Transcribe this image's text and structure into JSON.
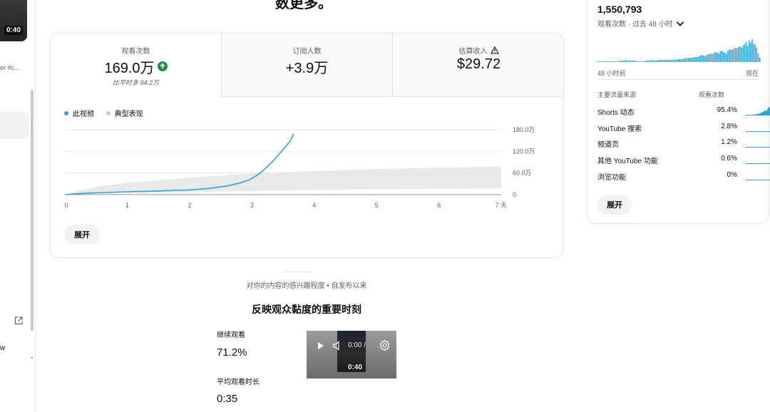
{
  "sidebar": {
    "thumbnail_duration": "0:40",
    "video_sub": "er #c...",
    "partial_text": "w"
  },
  "headline": "数更多。",
  "metrics": {
    "views": {
      "label": "观看次数",
      "value": "169.0万",
      "note": "比平时多 94.2万"
    },
    "subscribers": {
      "label": "订阅人数",
      "value": "+3.9万"
    },
    "revenue": {
      "label": "估算收入",
      "value": "$29.72"
    }
  },
  "legend": {
    "this_video": "此视频",
    "typical": "典型表现"
  },
  "expand_label": "展开",
  "chart_data": {
    "type": "line",
    "x_ticks": [
      "0",
      "1",
      "2",
      "3",
      "4",
      "5",
      "6",
      "7 天"
    ],
    "y_ticks": [
      "0",
      "60.0万",
      "120.0万",
      "180.0万"
    ],
    "ylim": [
      0,
      180
    ],
    "xlim": [
      0,
      7
    ],
    "grid": true,
    "legend_position": "top-left",
    "colors": {
      "this_video": "#2ba5d6",
      "typical": "#e2e2e2"
    },
    "series": [
      {
        "name": "此视频",
        "x": [
          0,
          0.25,
          0.5,
          1,
          1.5,
          2,
          2.3,
          2.6,
          2.8,
          2.95,
          3.05,
          3.15,
          3.25,
          3.35,
          3.45,
          3.55,
          3.62,
          3.67
        ],
        "y": [
          0,
          3,
          5,
          8,
          10,
          13,
          17,
          24,
          32,
          40,
          50,
          62,
          78,
          95,
          115,
          135,
          150,
          169
        ]
      },
      {
        "name": "典型表现",
        "x": [
          0,
          0.5,
          1,
          2,
          3,
          4,
          5,
          6,
          7
        ],
        "upper": [
          0,
          22,
          33,
          47,
          59,
          65,
          71,
          75,
          78
        ],
        "lower": [
          0,
          2,
          4,
          7,
          10,
          13,
          15,
          16,
          17
        ]
      }
    ]
  },
  "interest_text": "对你的内容的感兴趣程度 • 自发布以来",
  "moments_title": "反映观众黏度的重要时刻",
  "stats": {
    "continue_label": "继续观看",
    "continue_value": "71.2%",
    "avg_label": "平均观看时长",
    "avg_value": "0:35"
  },
  "player": {
    "time": "0:00 /",
    "duration": "0:40"
  },
  "realtime": {
    "total": "1,550,793",
    "subtitle": "观看次数 · 过去 48 小时",
    "ago": "48 小时前",
    "now": "现在",
    "hourly": [
      1,
      1,
      1,
      1,
      1,
      1,
      1,
      1,
      1,
      1,
      1,
      1,
      1,
      1,
      1,
      2,
      2,
      2,
      2,
      3,
      2,
      2,
      2,
      2,
      2,
      2,
      1,
      1,
      1,
      1,
      1,
      1,
      2,
      2,
      2,
      2,
      3,
      2,
      2,
      2,
      3,
      3,
      3,
      3,
      3,
      3,
      3,
      3,
      3,
      3,
      3,
      3,
      3,
      4,
      4,
      4,
      4,
      5,
      5,
      5,
      6,
      6,
      6,
      6,
      7,
      7,
      7,
      8,
      9,
      10,
      9,
      8,
      10,
      11,
      11,
      12,
      11,
      13,
      14,
      13,
      12,
      15,
      16,
      14,
      13,
      12,
      16,
      17,
      18,
      17,
      19,
      20,
      19,
      21,
      22,
      20,
      23,
      25,
      28,
      22,
      30,
      27,
      32,
      26,
      24,
      20,
      12,
      6
    ],
    "sources": {
      "header_source": "主要流量来源",
      "header_views": "观看次数",
      "rows": [
        {
          "name": "Shorts 动态",
          "pct": "95.4%"
        },
        {
          "name": "YouTube 搜索",
          "pct": "2.8%"
        },
        {
          "name": "频道页",
          "pct": "1.2%"
        },
        {
          "name": "其他 YouTube 功能",
          "pct": "0.6%"
        },
        {
          "name": "浏览功能",
          "pct": "0%"
        }
      ]
    }
  }
}
